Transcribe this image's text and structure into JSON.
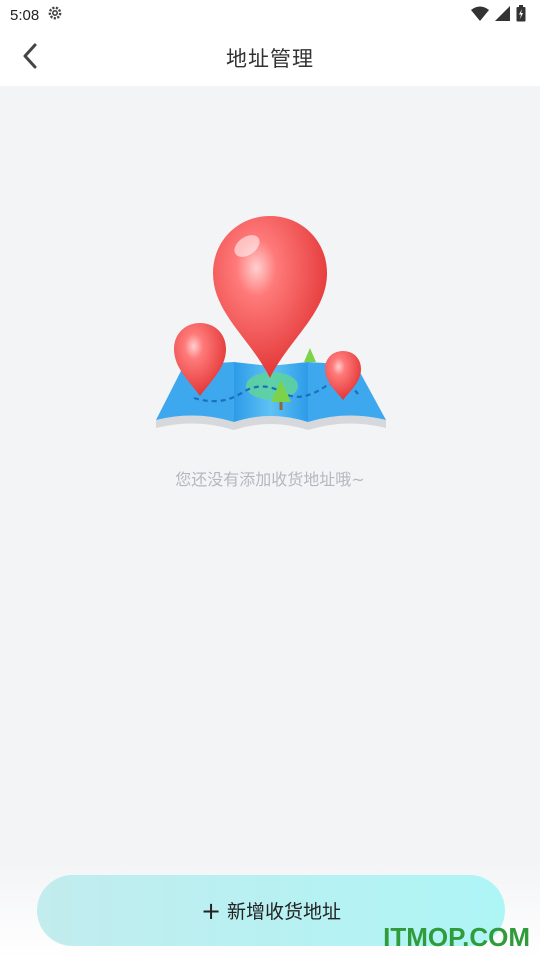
{
  "status_bar": {
    "time": "5:08",
    "icons": [
      "settings-icon",
      "wifi-icon",
      "signal-icon",
      "battery-icon"
    ]
  },
  "header": {
    "title": "地址管理",
    "back_icon": "chevron-left-icon"
  },
  "empty_state": {
    "illustration": "map-pin-illustration",
    "message": "您还没有添加收货地址哦~"
  },
  "add_button": {
    "icon": "+",
    "label": "新增收货地址"
  },
  "watermark": "ITMOP.COM",
  "colors": {
    "accent_gradient_start": "#c2ecee",
    "accent_gradient_end": "#aef5f6",
    "pin_red": "#f04a4a",
    "map_blue": "#3aa7ee"
  }
}
